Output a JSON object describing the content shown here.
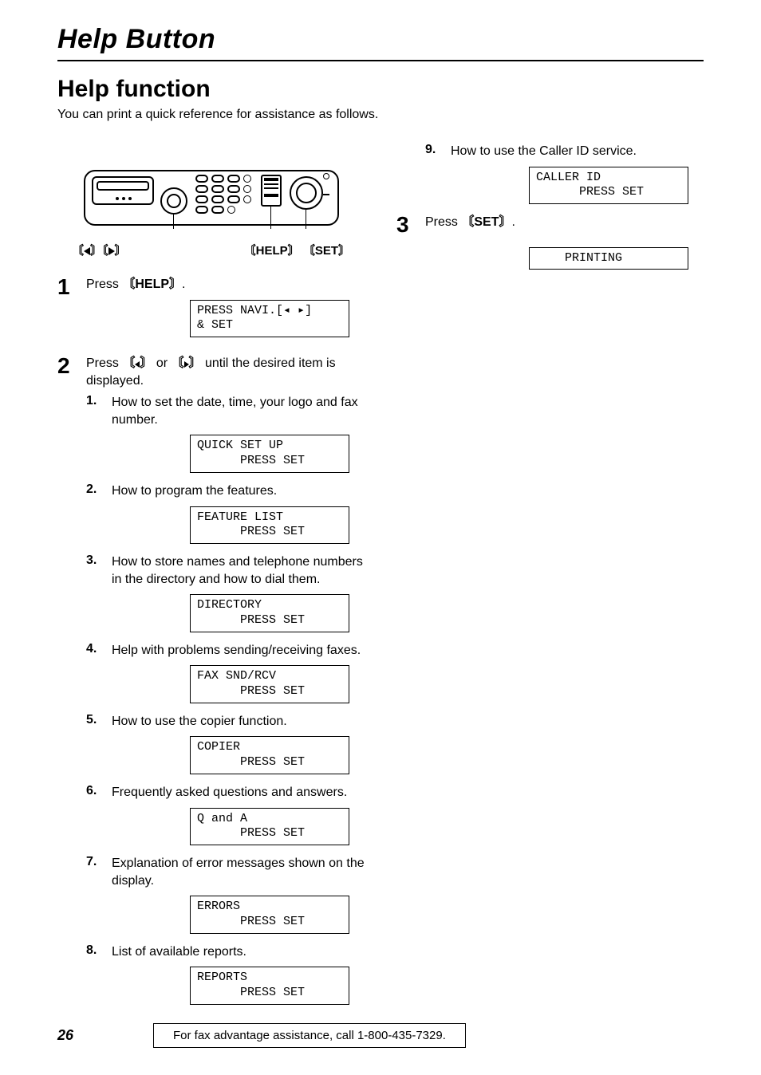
{
  "running_head": "Help Button",
  "h2": "Help function",
  "intro": "You can print a quick reference for assistance as follows.",
  "caption_left_open": "〘",
  "caption_left_close": "〙",
  "caption_help": "〘HELP〙",
  "caption_set": "〘SET〙",
  "step1": {
    "text_a": "Press ",
    "key": "〘HELP〙",
    "text_b": ".",
    "lcd": "PRESS NAVI.[◂ ▸]\n& SET"
  },
  "step2": {
    "text_a": "Press ",
    "key1_open": "〘",
    "key1_close": "〙",
    "or": " or ",
    "key2_open": "〘",
    "key2_close": "〙",
    "text_b": " until the desired item is displayed.",
    "items": [
      {
        "n": "1.",
        "t": "How to set the date, time, your logo and fax number.",
        "lcd": "QUICK SET UP\n      PRESS SET"
      },
      {
        "n": "2.",
        "t": "How to program the features.",
        "lcd": "FEATURE LIST\n      PRESS SET"
      },
      {
        "n": "3.",
        "t": "How to store names and telephone numbers in the directory and how to dial them.",
        "lcd": "DIRECTORY\n      PRESS SET"
      },
      {
        "n": "4.",
        "t": "Help with problems sending/receiving faxes.",
        "lcd": "FAX SND/RCV\n      PRESS SET"
      },
      {
        "n": "5.",
        "t": "How to use the copier function.",
        "lcd": "COPIER\n      PRESS SET"
      },
      {
        "n": "6.",
        "t": "Frequently asked questions and answers.",
        "lcd": "Q and A\n      PRESS SET"
      },
      {
        "n": "7.",
        "t": "Explanation of error messages shown on the display.",
        "lcd": "ERRORS\n      PRESS SET"
      },
      {
        "n": "8.",
        "t": "List of available reports.",
        "lcd": "REPORTS\n      PRESS SET"
      }
    ]
  },
  "right": {
    "item9": {
      "n": "9.",
      "t": "How to use the Caller ID service.",
      "lcd": "CALLER ID\n      PRESS SET"
    }
  },
  "step3": {
    "text_a": "Press ",
    "key": "〘SET〙",
    "text_b": ".",
    "lcd": "    PRINTING"
  },
  "footer": {
    "page": "26",
    "text": "For fax advantage assistance, call 1-800-435-7329."
  }
}
